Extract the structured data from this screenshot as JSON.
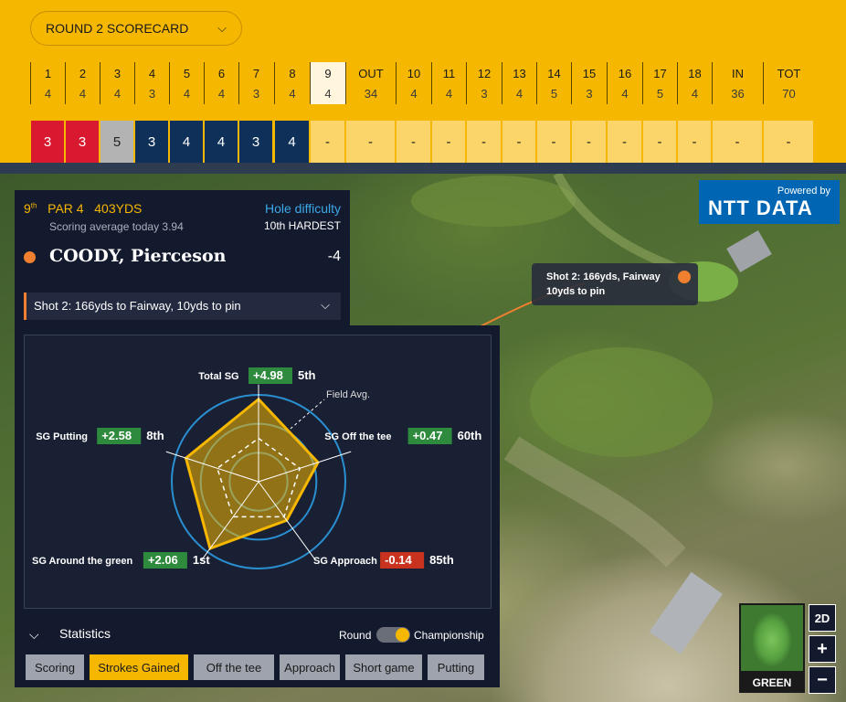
{
  "scorecard": {
    "round_label": "ROUND 2 SCORECARD",
    "holes": [
      {
        "hole": "1",
        "par": "4",
        "score": "3"
      },
      {
        "hole": "2",
        "par": "4",
        "score": "3"
      },
      {
        "hole": "3",
        "par": "4",
        "score": "5"
      },
      {
        "hole": "4",
        "par": "3",
        "score": "3"
      },
      {
        "hole": "5",
        "par": "4",
        "score": "4"
      },
      {
        "hole": "6",
        "par": "4",
        "score": "4"
      },
      {
        "hole": "7",
        "par": "3",
        "score": "3"
      },
      {
        "hole": "8",
        "par": "4",
        "score": "4"
      },
      {
        "hole": "9",
        "par": "4",
        "score": "-"
      },
      {
        "hole": "OUT",
        "par": "34",
        "score": "-"
      },
      {
        "hole": "10",
        "par": "4",
        "score": "-"
      },
      {
        "hole": "11",
        "par": "4",
        "score": "-"
      },
      {
        "hole": "12",
        "par": "3",
        "score": "-"
      },
      {
        "hole": "13",
        "par": "4",
        "score": "-"
      },
      {
        "hole": "14",
        "par": "5",
        "score": "-"
      },
      {
        "hole": "15",
        "par": "3",
        "score": "-"
      },
      {
        "hole": "16",
        "par": "4",
        "score": "-"
      },
      {
        "hole": "17",
        "par": "5",
        "score": "-"
      },
      {
        "hole": "18",
        "par": "4",
        "score": "-"
      },
      {
        "hole": "IN",
        "par": "36",
        "score": "-"
      },
      {
        "hole": "TOT",
        "par": "70",
        "score": "-"
      }
    ],
    "colors": {
      "birdie": "#d8192f",
      "bogey": "#b3b3b3",
      "par": "#0f3159",
      "empty": "#fbd46a"
    }
  },
  "hole_info": {
    "number": "9",
    "ordinal": "th",
    "par_label": "PAR 4",
    "yards": "403YDS",
    "scoring_avg": "Scoring average today 3.94",
    "difficulty_label": "Hole difficulty",
    "difficulty_value": "10th HARDEST"
  },
  "player": {
    "name": "COODY, Pierceson",
    "score": "-4"
  },
  "shot_select": "Shot 2: 166yds to Fairway, 10yds to pin",
  "map_tooltip": {
    "line1": "Shot 2: 166yds, Fairway",
    "line2": "10yds to pin"
  },
  "sponsor": {
    "powered": "Powered by",
    "brand": "NTT DATA"
  },
  "chart_data": {
    "type": "radar",
    "axes": [
      {
        "label": "Total SG",
        "value": "+4.98",
        "rank": "5th",
        "color": "#2e8b3e"
      },
      {
        "label": "SG Off the tee",
        "value": "+0.47",
        "rank": "60th",
        "color": "#2e8b3e"
      },
      {
        "label": "SG Approach",
        "value": "-0.14",
        "rank": "85th",
        "color": "#c8321e"
      },
      {
        "label": "SG Around the green",
        "value": "+2.06",
        "rank": "1st",
        "color": "#2e8b3e"
      },
      {
        "label": "SG Putting",
        "value": "+2.58",
        "rank": "8th",
        "color": "#2e8b3e"
      }
    ],
    "player_values": [
      0.95,
      0.72,
      0.55,
      0.95,
      0.88
    ],
    "field_values": [
      0.5,
      0.5,
      0.5,
      0.5,
      0.5
    ],
    "field_label": "Field Avg.",
    "rings": 3
  },
  "statistics": {
    "label": "Statistics",
    "toggle_left": "Round",
    "toggle_right": "Championship",
    "tabs": [
      "Scoring",
      "Strokes Gained",
      "Off the tee",
      "Approach",
      "Short game",
      "Putting"
    ],
    "active_tab": "Strokes Gained"
  },
  "map_controls": {
    "view_2d": "2D",
    "zoom_in": "+",
    "zoom_out": "−",
    "minimap_label": "GREEN"
  }
}
